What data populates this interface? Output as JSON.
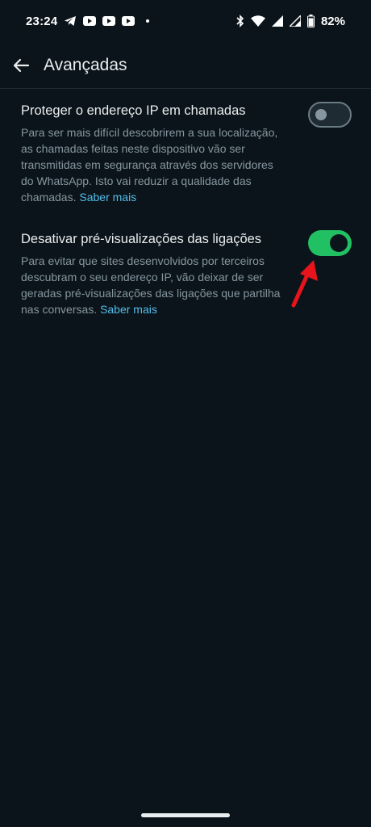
{
  "status_bar": {
    "time": "23:24",
    "battery": "82%",
    "notification_icons": [
      "telegram-icon",
      "youtube-icon",
      "youtube-icon",
      "youtube-icon",
      "dot-icon"
    ],
    "system_icons": [
      "bluetooth-icon",
      "wifi-icon",
      "signal-icon",
      "signal-icon",
      "battery-icon"
    ]
  },
  "header": {
    "title": "Avançadas",
    "back_icon": "arrow-left-icon"
  },
  "settings": [
    {
      "title": "Proteger o endereço IP em chamadas",
      "description": "Para ser mais difícil descobrirem a sua localização, as chamadas feitas neste dispositivo vão ser transmitidas em segurança através dos servidores do WhatsApp. Isto vai reduzir a qualidade das chamadas.",
      "link": "Saber mais",
      "enabled": false
    },
    {
      "title": "Desativar pré-visualizações das ligações",
      "description": "Para evitar que sites desenvolvidos por terceiros descubram o seu endereço IP, vão deixar de ser geradas pré-visualizações das ligações que partilha nas conversas.",
      "link": "Saber mais",
      "enabled": true
    }
  ],
  "colors": {
    "background": "#0b141a",
    "accent_green": "#21c063",
    "link_blue": "#53bdeb",
    "annotation_red": "#e8141c"
  }
}
